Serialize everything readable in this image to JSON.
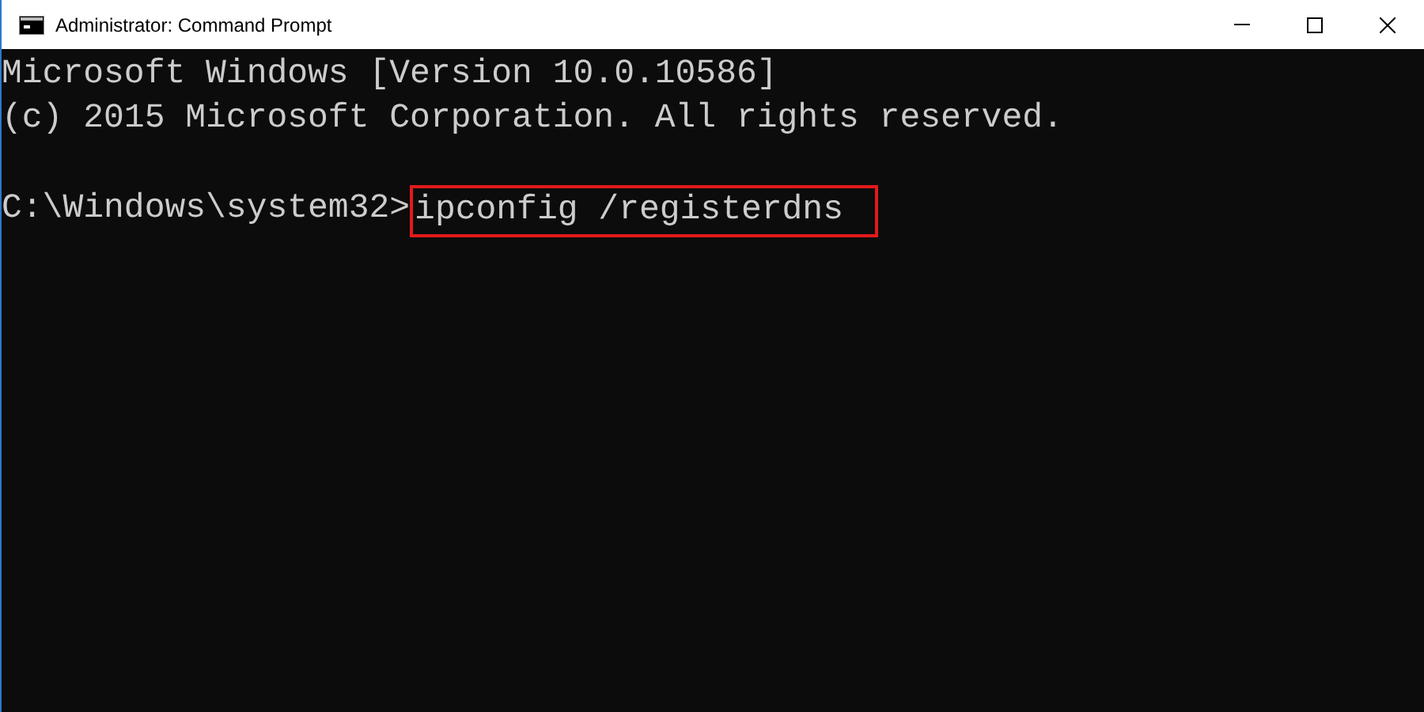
{
  "window": {
    "title": "Administrator: Command Prompt"
  },
  "console": {
    "lines": [
      {
        "kind": "output",
        "text": "Microsoft Windows [Version 10.0.10586]"
      },
      {
        "kind": "output",
        "text": "(c) 2015 Microsoft Corporation. All rights reserved."
      },
      {
        "kind": "blank"
      },
      {
        "kind": "prompt",
        "prompt": "C:\\Windows\\system32>",
        "command": "ipconfig /registerdns",
        "highlighted": true
      }
    ]
  }
}
